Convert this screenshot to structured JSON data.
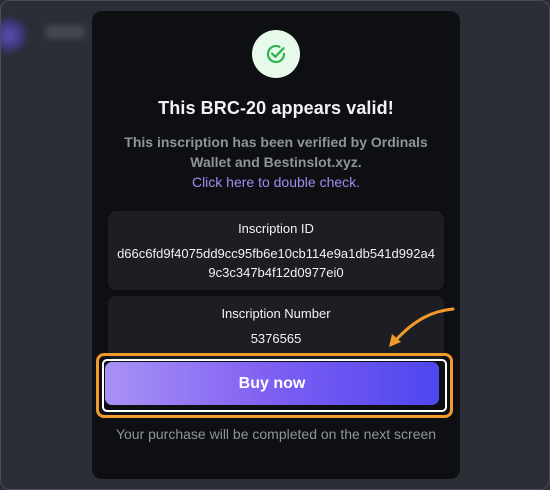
{
  "background": {
    "blurred_label": "Cade"
  },
  "modal": {
    "status_icon": "check-circle-icon",
    "title": "This BRC-20 appears valid!",
    "description": "This inscription has been verified by Ordinals Wallet and Bestinslot.xyz.",
    "link_text": "Click here to double check.",
    "inscription_id": {
      "label": "Inscription ID",
      "value": "d66c6fd9f4075dd9cc95fb6e10cb114e9a1db541d992a49c3c347b4f12d0977ei0"
    },
    "inscription_number": {
      "label": "Inscription Number",
      "value": "5376565"
    },
    "buy_button_label": "Buy now",
    "footnote": "Your purchase will be completed on the next screen"
  },
  "colors": {
    "accent_link": "#a58af0",
    "highlight": "#f09a2a",
    "success_icon": "#2fb24c",
    "button_gradient_start": "#a992f4",
    "button_gradient_end": "#4e46f0"
  }
}
